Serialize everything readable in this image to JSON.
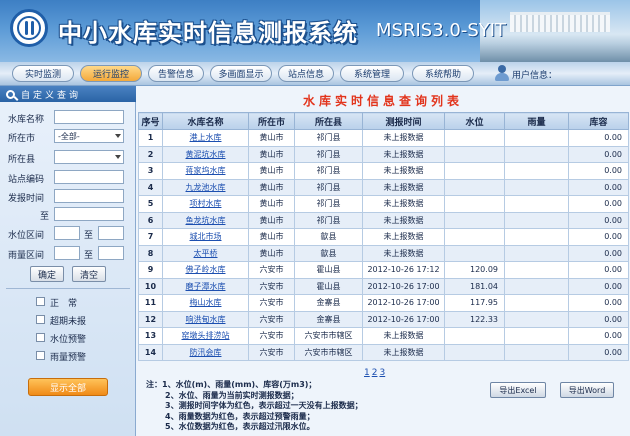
{
  "header": {
    "title": "中小水库实时信息测报系统",
    "subtitle": "MSRIS3.0-SYIT"
  },
  "nav": {
    "items": [
      {
        "label": "实时监测"
      },
      {
        "label": "运行监控"
      },
      {
        "label": "告警信息"
      },
      {
        "label": "多画面显示"
      },
      {
        "label": "站点信息"
      },
      {
        "label": "系统管理"
      },
      {
        "label": "系统帮助"
      }
    ],
    "user_label": "用户信息：",
    "active_index": 1
  },
  "sidebar": {
    "heading": "自定义查询",
    "fields": {
      "reservoir_name": "水库名称",
      "city": "所在市",
      "city_value": "-全部-",
      "county": "所在县",
      "county_value": "",
      "station_code": "站点编码",
      "report_time": "发报时间",
      "to": "至",
      "water_level_range": "水位区间",
      "rainfall_range": "雨量区间",
      "to_short": "至"
    },
    "buttons": {
      "confirm": "确定",
      "clear": "清空"
    },
    "checks": [
      {
        "label": "正　常"
      },
      {
        "label": "超期未报"
      },
      {
        "label": "水位预警"
      },
      {
        "label": "雨量预警"
      }
    ],
    "show_all": "显示全部"
  },
  "main": {
    "title": "水库实时信息查询列表",
    "columns": [
      "序号",
      "水库名称",
      "所在市",
      "所在县",
      "测报时间",
      "水位",
      "雨量",
      "库容"
    ],
    "rows": [
      {
        "idx": "1",
        "name": "港上水库",
        "city": "黄山市",
        "county": "祁门县",
        "time": "未上报数据",
        "level": "",
        "rain": "",
        "storage": "0.00"
      },
      {
        "idx": "2",
        "name": "黄泥坑水库",
        "city": "黄山市",
        "county": "祁门县",
        "time": "未上报数据",
        "level": "",
        "rain": "",
        "storage": "0.00"
      },
      {
        "idx": "3",
        "name": "蒋家坞水库",
        "city": "黄山市",
        "county": "祁门县",
        "time": "未上报数据",
        "level": "",
        "rain": "",
        "storage": "0.00"
      },
      {
        "idx": "4",
        "name": "九龙池水库",
        "city": "黄山市",
        "county": "祁门县",
        "time": "未上报数据",
        "level": "",
        "rain": "",
        "storage": "0.00"
      },
      {
        "idx": "5",
        "name": "项村水库",
        "city": "黄山市",
        "county": "祁门县",
        "time": "未上报数据",
        "level": "",
        "rain": "",
        "storage": "0.00"
      },
      {
        "idx": "6",
        "name": "鱼龙坑水库",
        "city": "黄山市",
        "county": "祁门县",
        "time": "未上报数据",
        "level": "",
        "rain": "",
        "storage": "0.00"
      },
      {
        "idx": "7",
        "name": "城北市场",
        "city": "黄山市",
        "county": "歙县",
        "time": "未上报数据",
        "level": "",
        "rain": "",
        "storage": "0.00"
      },
      {
        "idx": "8",
        "name": "太平桥",
        "city": "黄山市",
        "county": "歙县",
        "time": "未上报数据",
        "level": "",
        "rain": "",
        "storage": "0.00"
      },
      {
        "idx": "9",
        "name": "佛子岭水库",
        "city": "六安市",
        "county": "霍山县",
        "time": "2012-10-26 17:12",
        "level": "120.09",
        "rain": "",
        "storage": "0.00"
      },
      {
        "idx": "10",
        "name": "磨子潭水库",
        "city": "六安市",
        "county": "霍山县",
        "time": "2012-10-26 17:00",
        "level": "181.04",
        "rain": "",
        "storage": "0.00"
      },
      {
        "idx": "11",
        "name": "梅山水库",
        "city": "六安市",
        "county": "金寨县",
        "time": "2012-10-26 17:00",
        "level": "117.95",
        "rain": "",
        "storage": "0.00"
      },
      {
        "idx": "12",
        "name": "响洪甸水库",
        "city": "六安市",
        "county": "金寨县",
        "time": "2012-10-26 17:00",
        "level": "122.33",
        "rain": "",
        "storage": "0.00"
      },
      {
        "idx": "13",
        "name": "窑墩头排涝站",
        "city": "六安市",
        "county": "六安市市辖区",
        "time": "未上报数据",
        "level": "",
        "rain": "",
        "storage": "0.00"
      },
      {
        "idx": "14",
        "name": "防汛会库",
        "city": "六安市",
        "county": "六安市市辖区",
        "time": "未上报数据",
        "level": "",
        "rain": "",
        "storage": "0.00"
      }
    ],
    "pager": [
      "1",
      "2",
      "3"
    ],
    "notes": [
      "注：1、水位(m)、雨量(mm)、库容(万m3)；",
      "2、水位、雨量为当前实时测报数据；",
      "3、测报时间字体为红色，表示超过一天没有上报数据；",
      "4、雨量数据为红色，表示超过预警雨量；",
      "5、水位数据为红色，表示超过汛限水位。"
    ],
    "export_excel": "导出Excel",
    "export_word": "导出Word"
  }
}
